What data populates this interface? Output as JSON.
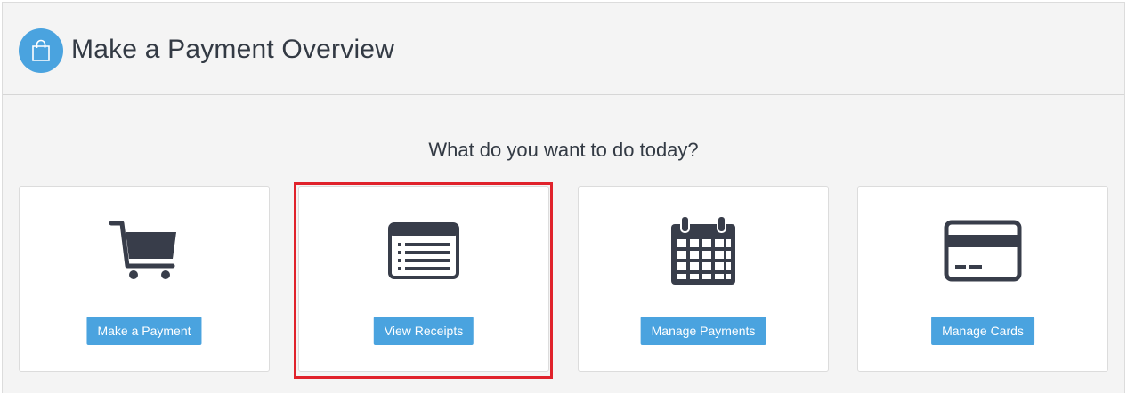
{
  "header": {
    "title": "Make a Payment Overview",
    "icon": "shopping-bag-icon",
    "icon_color": "#4aa3df"
  },
  "prompt": "What do you want to do today?",
  "cards": [
    {
      "icon": "shopping-cart-icon",
      "button_label": "Make a Payment"
    },
    {
      "icon": "receipt-list-icon",
      "button_label": "View Receipts",
      "highlighted": true
    },
    {
      "icon": "calendar-icon",
      "button_label": "Manage Payments"
    },
    {
      "icon": "credit-card-icon",
      "button_label": "Manage Cards"
    }
  ],
  "colors": {
    "accent": "#4aa3df",
    "icon": "#383d4a",
    "text": "#333a44",
    "highlight": "#e0222b"
  }
}
